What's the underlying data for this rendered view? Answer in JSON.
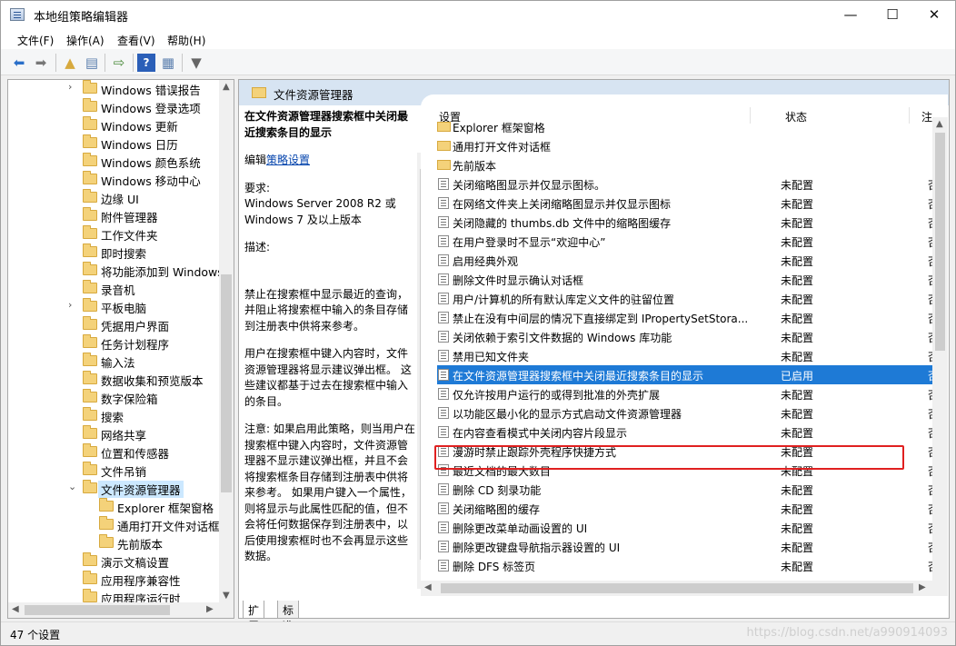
{
  "window": {
    "title": "本地组策略编辑器",
    "controls": {
      "minimize": "—",
      "maximize": "☐",
      "close": "✕"
    }
  },
  "menu": [
    "文件(F)",
    "操作(A)",
    "查看(V)",
    "帮助(H)"
  ],
  "toolbar": {
    "icons": [
      "back-icon",
      "forward-icon",
      "up-folder-icon",
      "show-hide-tree-icon",
      "export-list-icon",
      "help-icon",
      "properties-view-icon",
      "filter-icon"
    ]
  },
  "tree": {
    "items": [
      {
        "label": "Windows 错误报告",
        "expander": "›"
      },
      {
        "label": "Windows 登录选项",
        "expander": ""
      },
      {
        "label": "Windows 更新",
        "expander": ""
      },
      {
        "label": "Windows 日历",
        "expander": ""
      },
      {
        "label": "Windows 颜色系统",
        "expander": ""
      },
      {
        "label": "Windows 移动中心",
        "expander": ""
      },
      {
        "label": "边缘 UI",
        "expander": ""
      },
      {
        "label": "附件管理器",
        "expander": ""
      },
      {
        "label": "工作文件夹",
        "expander": ""
      },
      {
        "label": "即时搜索",
        "expander": ""
      },
      {
        "label": "将功能添加到 Windows",
        "expander": ""
      },
      {
        "label": "录音机",
        "expander": ""
      },
      {
        "label": "平板电脑",
        "expander": "›"
      },
      {
        "label": "凭据用户界面",
        "expander": ""
      },
      {
        "label": "任务计划程序",
        "expander": ""
      },
      {
        "label": "输入法",
        "expander": ""
      },
      {
        "label": "数据收集和预览版本",
        "expander": ""
      },
      {
        "label": "数字保险箱",
        "expander": ""
      },
      {
        "label": "搜索",
        "expander": ""
      },
      {
        "label": "网络共享",
        "expander": ""
      },
      {
        "label": "位置和传感器",
        "expander": ""
      },
      {
        "label": "文件吊销",
        "expander": ""
      },
      {
        "label": "文件资源管理器",
        "expander": "⌄",
        "selected": true
      },
      {
        "label": "Explorer 框架窗格",
        "expander": "",
        "child": true
      },
      {
        "label": "通用打开文件对话框",
        "expander": "",
        "child": true
      },
      {
        "label": "先前版本",
        "expander": "",
        "child": true
      },
      {
        "label": "演示文稿设置",
        "expander": ""
      },
      {
        "label": "应用程序兼容性",
        "expander": ""
      },
      {
        "label": "应用程序运行时",
        "expander": ""
      }
    ]
  },
  "right": {
    "header": "文件资源管理器",
    "description": {
      "title": "在文件资源管理器搜索框中关闭最近搜索条目的显示",
      "edit_prefix": "编辑",
      "edit_link": "策略设置",
      "requirements_label": "要求:",
      "requirements": "Windows Server 2008 R2 或 Windows 7 及以上版本",
      "description_label": "描述:",
      "p1": "禁止在搜索框中显示最近的查询，并阻止将搜索框中输入的条目存储到注册表中供将来参考。",
      "p2": "用户在搜索框中键入内容时，文件资源管理器将显示建议弹出框。 这些建议都基于过去在搜索框中输入的条目。",
      "p3": "注意: 如果启用此策略，则当用户在搜索框中键入内容时，文件资源管理器不显示建议弹出框，并且不会将搜索框条目存储到注册表中供将来参考。 如果用户键入一个属性，则将显示与此属性匹配的值，但不会将任何数据保存到注册表中，以后使用搜索框时也不会再显示这些数据。"
    },
    "columns": {
      "setting": "设置",
      "state": "状态",
      "note": "注"
    },
    "rows": [
      {
        "type": "folder",
        "name": "Explorer 框架窗格",
        "state": "",
        "note": ""
      },
      {
        "type": "folder",
        "name": "通用打开文件对话框",
        "state": "",
        "note": ""
      },
      {
        "type": "folder",
        "name": "先前版本",
        "state": "",
        "note": ""
      },
      {
        "type": "policy",
        "name": "关闭缩略图显示并仅显示图标。",
        "state": "未配置",
        "note": "否"
      },
      {
        "type": "policy",
        "name": "在网络文件夹上关闭缩略图显示并仅显示图标",
        "state": "未配置",
        "note": "否"
      },
      {
        "type": "policy",
        "name": "关闭隐藏的 thumbs.db 文件中的缩略图缓存",
        "state": "未配置",
        "note": "否"
      },
      {
        "type": "policy",
        "name": "在用户登录时不显示“欢迎中心”",
        "state": "未配置",
        "note": "否"
      },
      {
        "type": "policy",
        "name": "启用经典外观",
        "state": "未配置",
        "note": "否"
      },
      {
        "type": "policy",
        "name": "删除文件时显示确认对话框",
        "state": "未配置",
        "note": "否"
      },
      {
        "type": "policy",
        "name": "用户/计算机的所有默认库定义文件的驻留位置",
        "state": "未配置",
        "note": "否"
      },
      {
        "type": "policy",
        "name": "禁止在没有中间层的情况下直接绑定到 IPropertySetStora...",
        "state": "未配置",
        "note": "否"
      },
      {
        "type": "policy",
        "name": "关闭依赖于索引文件数据的 Windows 库功能",
        "state": "未配置",
        "note": "否"
      },
      {
        "type": "policy",
        "name": "禁用已知文件夹",
        "state": "未配置",
        "note": "否"
      },
      {
        "type": "policy",
        "name": "在文件资源管理器搜索框中关闭最近搜索条目的显示",
        "state": "已启用",
        "note": "否",
        "highlighted": true
      },
      {
        "type": "policy",
        "name": "仅允许按用户运行的或得到批准的外壳扩展",
        "state": "未配置",
        "note": "否"
      },
      {
        "type": "policy",
        "name": "以功能区最小化的显示方式启动文件资源管理器",
        "state": "未配置",
        "note": "否"
      },
      {
        "type": "policy",
        "name": "在内容查看模式中关闭内容片段显示",
        "state": "未配置",
        "note": "否"
      },
      {
        "type": "policy",
        "name": "漫游时禁止跟踪外壳程序快捷方式",
        "state": "未配置",
        "note": "否"
      },
      {
        "type": "policy",
        "name": "最近文档的最大数目",
        "state": "未配置",
        "note": "否"
      },
      {
        "type": "policy",
        "name": "删除 CD 刻录功能",
        "state": "未配置",
        "note": "否"
      },
      {
        "type": "policy",
        "name": "关闭缩略图的缓存",
        "state": "未配置",
        "note": "否"
      },
      {
        "type": "policy",
        "name": "删除更改菜单动画设置的 UI",
        "state": "未配置",
        "note": "否"
      },
      {
        "type": "policy",
        "name": "删除更改键盘导航指示器设置的 UI",
        "state": "未配置",
        "note": "否"
      },
      {
        "type": "policy",
        "name": "删除 DFS 标签页",
        "state": "未配置",
        "note": "否"
      }
    ]
  },
  "tabs": [
    "扩展",
    "标准"
  ],
  "status": {
    "text": "47 个设置",
    "watermark": "https://blog.csdn.net/a990914093"
  }
}
